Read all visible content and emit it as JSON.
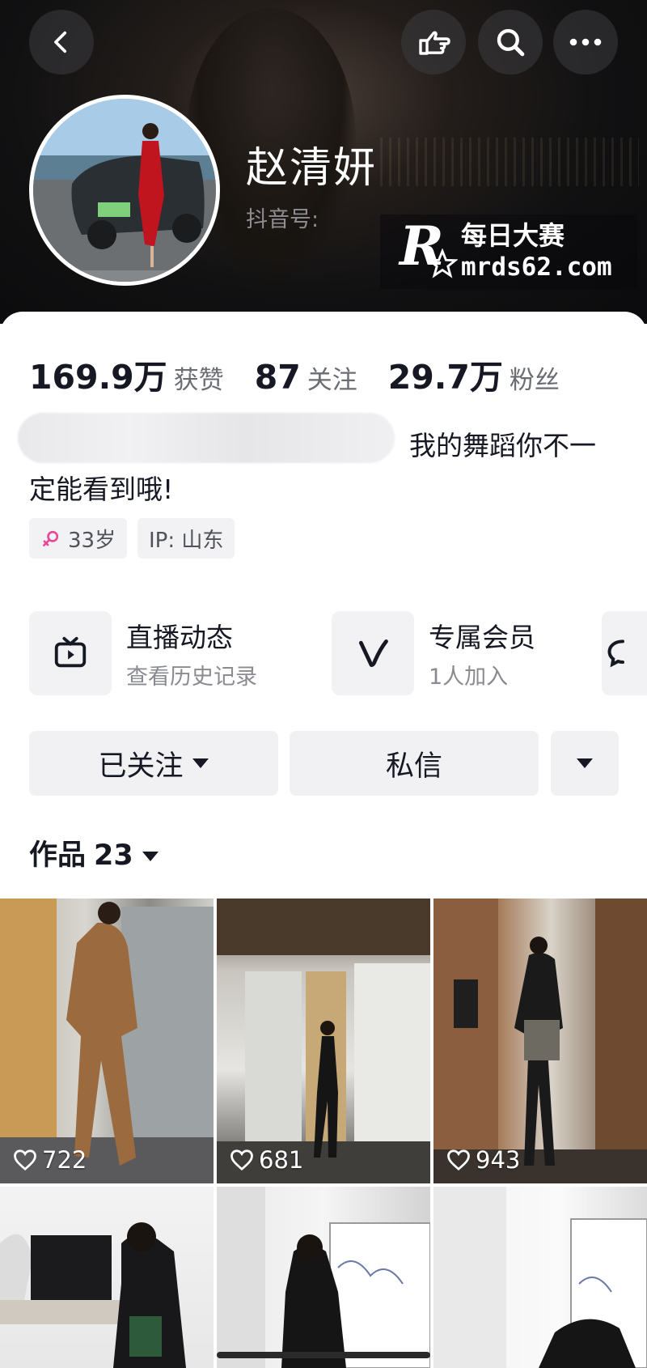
{
  "header": {
    "username": "赵清妍",
    "douyin_id_label": "抖音号:",
    "watermark": {
      "logo_letter": "R",
      "title": "每日大赛",
      "url": "mrds62.com"
    }
  },
  "stats": [
    {
      "value": "169.9万",
      "label": "获赞"
    },
    {
      "value": "87",
      "label": "关注"
    },
    {
      "value": "29.7万",
      "label": "粉丝"
    }
  ],
  "bio": {
    "line1": "我的舞蹈你不一",
    "line2": "定能看到哦!"
  },
  "tags": {
    "age": "33岁",
    "ip": "IP: 山东"
  },
  "features": [
    {
      "title": "直播动态",
      "subtitle": "查看历史记录",
      "icon": "tv-icon"
    },
    {
      "title": "专属会员",
      "subtitle": "1人加入",
      "icon": "v-icon"
    }
  ],
  "actions": {
    "follow_label": "已关注",
    "message_label": "私信"
  },
  "works": {
    "label": "作品",
    "count": "23"
  },
  "videos": [
    {
      "likes": "722"
    },
    {
      "likes": "681"
    },
    {
      "likes": "943"
    },
    {
      "likes": ""
    },
    {
      "likes": ""
    },
    {
      "likes": ""
    }
  ],
  "colors": {
    "accent_female": "#e8479a",
    "text_primary": "#161823",
    "text_secondary": "#6b6d74",
    "button_bg": "#f1f1f3"
  }
}
